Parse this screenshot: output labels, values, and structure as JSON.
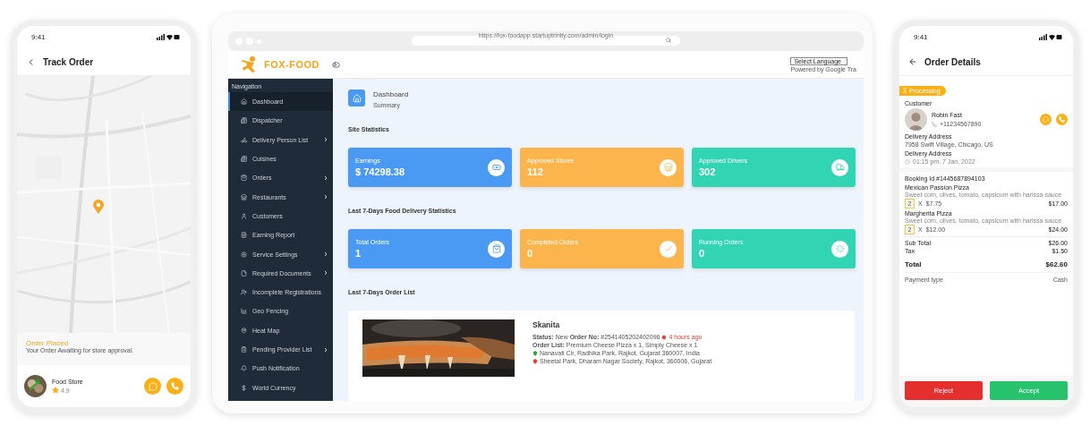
{
  "track_phone": {
    "status_time": "9:41",
    "title": "Track Order",
    "order_status": {
      "title": "Order Placed",
      "message": "Your Order Awaiting for store approval."
    },
    "store": {
      "name": "Food Store",
      "rating": "4.9"
    }
  },
  "admin": {
    "url": "https://fox-foodapp.startuptrinity.com/admin/login",
    "logo": "FOX-FOOD",
    "language_select": "Select Language",
    "powered_by": "Powered by Google Tra",
    "navigation": {
      "heading": "Navigation",
      "items": [
        {
          "label": "Dashboard",
          "selected": true,
          "has_submenu": false
        },
        {
          "label": "Dispatcher",
          "selected": false,
          "has_submenu": false
        },
        {
          "label": "Delivery Person List",
          "selected": false,
          "has_submenu": true
        },
        {
          "label": "Cuisines",
          "selected": false,
          "has_submenu": false
        },
        {
          "label": "Orders",
          "selected": false,
          "has_submenu": true
        },
        {
          "label": "Restaurants",
          "selected": false,
          "has_submenu": true
        },
        {
          "label": "Customers",
          "selected": false,
          "has_submenu": false
        },
        {
          "label": "Earning Report",
          "selected": false,
          "has_submenu": false
        },
        {
          "label": "Service Settings",
          "selected": false,
          "has_submenu": true
        },
        {
          "label": "Required Documents",
          "selected": false,
          "has_submenu": true
        },
        {
          "label": "Incomplete Registrations",
          "selected": false,
          "has_submenu": false
        },
        {
          "label": "Geo Fencing",
          "selected": false,
          "has_submenu": false
        },
        {
          "label": "Heat Map",
          "selected": false,
          "has_submenu": false
        },
        {
          "label": "Pending Provider List",
          "selected": false,
          "has_submenu": true
        },
        {
          "label": "Push Notification",
          "selected": false,
          "has_submenu": false
        },
        {
          "label": "World Currency",
          "selected": false,
          "has_submenu": false
        }
      ]
    },
    "page_title": "Dashboard",
    "page_subtitle": "Summary",
    "sections": [
      {
        "title": "Site Statistics",
        "cards": [
          {
            "label": "Earnings",
            "value": "$ 74298.38",
            "color": "#4a9af4"
          },
          {
            "label": "Approved Stores",
            "value": "112",
            "color": "#fcb54c"
          },
          {
            "label": "Approved Drivers",
            "value": "302",
            "color": "#31d5b4"
          }
        ]
      },
      {
        "title": "Last 7-Days Food Delivery Statistics",
        "cards": [
          {
            "label": "Total Orders",
            "value": "1",
            "color": "#4a9af4"
          },
          {
            "label": "Completed Orders",
            "value": "0",
            "color": "#fcb54c"
          },
          {
            "label": "Running Orders",
            "value": "0",
            "color": "#31d5b4"
          }
        ]
      }
    ],
    "order_list": {
      "title": "Last 7-Days Order List",
      "orders": [
        {
          "name": "Skanita",
          "status": "**Status:** New **Order No:** #2541405202402096",
          "time": "4 hours ago",
          "items": "**Order List:** Premium Cheese Pizza x 1, Simply Cheese x 1",
          "pickup": "Nanavati Cir, Radhika Park, Rajkot, Gujarat 360007, India",
          "dropoff": "Sheetal Park, Dharam Nagar Society, Rajkot, 360006, Gujarat"
        }
      ]
    }
  },
  "details_phone": {
    "status_time": "9:41",
    "title": "Order Details",
    "badge": "Processing",
    "customer_label": "Customer",
    "customer": {
      "name": "Robin Fast",
      "phone": "+11234567890"
    },
    "address_label": "Delivery Address",
    "address": "7958 Swift Village, Chicago, US",
    "time_label": "Delivery Address",
    "time": "01:15 pm, 7 Jan, 2022",
    "booking_id": "Booking Id #1445687894103",
    "items": [
      {
        "name": "Mexican Passion Pizza",
        "description": "Sweet corn, olives, tomato, capsicum with harissa sauce",
        "quantity": "2",
        "times": "X",
        "unit_price": "$7.75",
        "total": "$17.00"
      },
      {
        "name": "Margherita Pizza",
        "description": "Sweet corn, olives, tomato, capsicum with harissa sauce",
        "quantity": "2",
        "times": "X",
        "unit_price": "$12.00",
        "total": "$24.00"
      }
    ],
    "summary": [
      {
        "kind": "line",
        "label": "Sub Total",
        "value": "$26.00"
      },
      {
        "kind": "line",
        "label": "Tax",
        "value": "$1.50"
      },
      {
        "kind": "total",
        "label": "Total",
        "value": "$62.60"
      },
      {
        "kind": "payment",
        "label": "Payment type",
        "value": "Cash"
      }
    ],
    "buttons": [
      {
        "label": "Reject",
        "kind": "reject"
      },
      {
        "label": "Accept",
        "kind": "accept"
      }
    ]
  }
}
